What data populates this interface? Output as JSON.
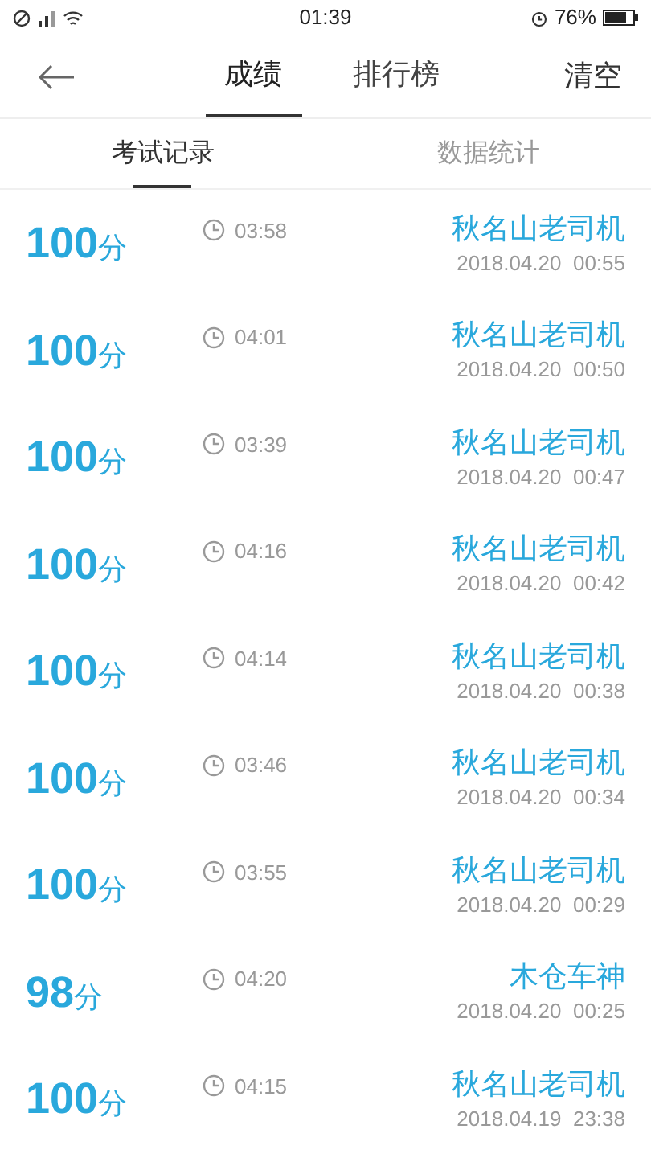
{
  "status_bar": {
    "time": "01:39",
    "battery": "76%"
  },
  "tabs": [
    {
      "label": "成绩",
      "selected": true
    },
    {
      "label": "排行榜",
      "selected": false
    }
  ],
  "action": "清空",
  "subtabs": [
    {
      "label": "考试记录",
      "selected": true
    },
    {
      "label": "数据统计",
      "selected": false
    }
  ],
  "records": [
    {
      "score": "100",
      "unit": "分",
      "duration": "03:58",
      "name": "秋名山老司机",
      "date": "2018.04.20  00:55"
    },
    {
      "score": "100",
      "unit": "分",
      "duration": "04:01",
      "name": "秋名山老司机",
      "date": "2018.04.20  00:50"
    },
    {
      "score": "100",
      "unit": "分",
      "duration": "03:39",
      "name": "秋名山老司机",
      "date": "2018.04.20  00:47"
    },
    {
      "score": "100",
      "unit": "分",
      "duration": "04:16",
      "name": "秋名山老司机",
      "date": "2018.04.20  00:42"
    },
    {
      "score": "100",
      "unit": "分",
      "duration": "04:14",
      "name": "秋名山老司机",
      "date": "2018.04.20  00:38"
    },
    {
      "score": "100",
      "unit": "分",
      "duration": "03:46",
      "name": "秋名山老司机",
      "date": "2018.04.20  00:34"
    },
    {
      "score": "100",
      "unit": "分",
      "duration": "03:55",
      "name": "秋名山老司机",
      "date": "2018.04.20  00:29"
    },
    {
      "score": "98",
      "unit": "分",
      "duration": "04:20",
      "name": "木仓车神",
      "date": "2018.04.20  00:25"
    },
    {
      "score": "100",
      "unit": "分",
      "duration": "04:15",
      "name": "秋名山老司机",
      "date": "2018.04.19  23:38"
    }
  ]
}
